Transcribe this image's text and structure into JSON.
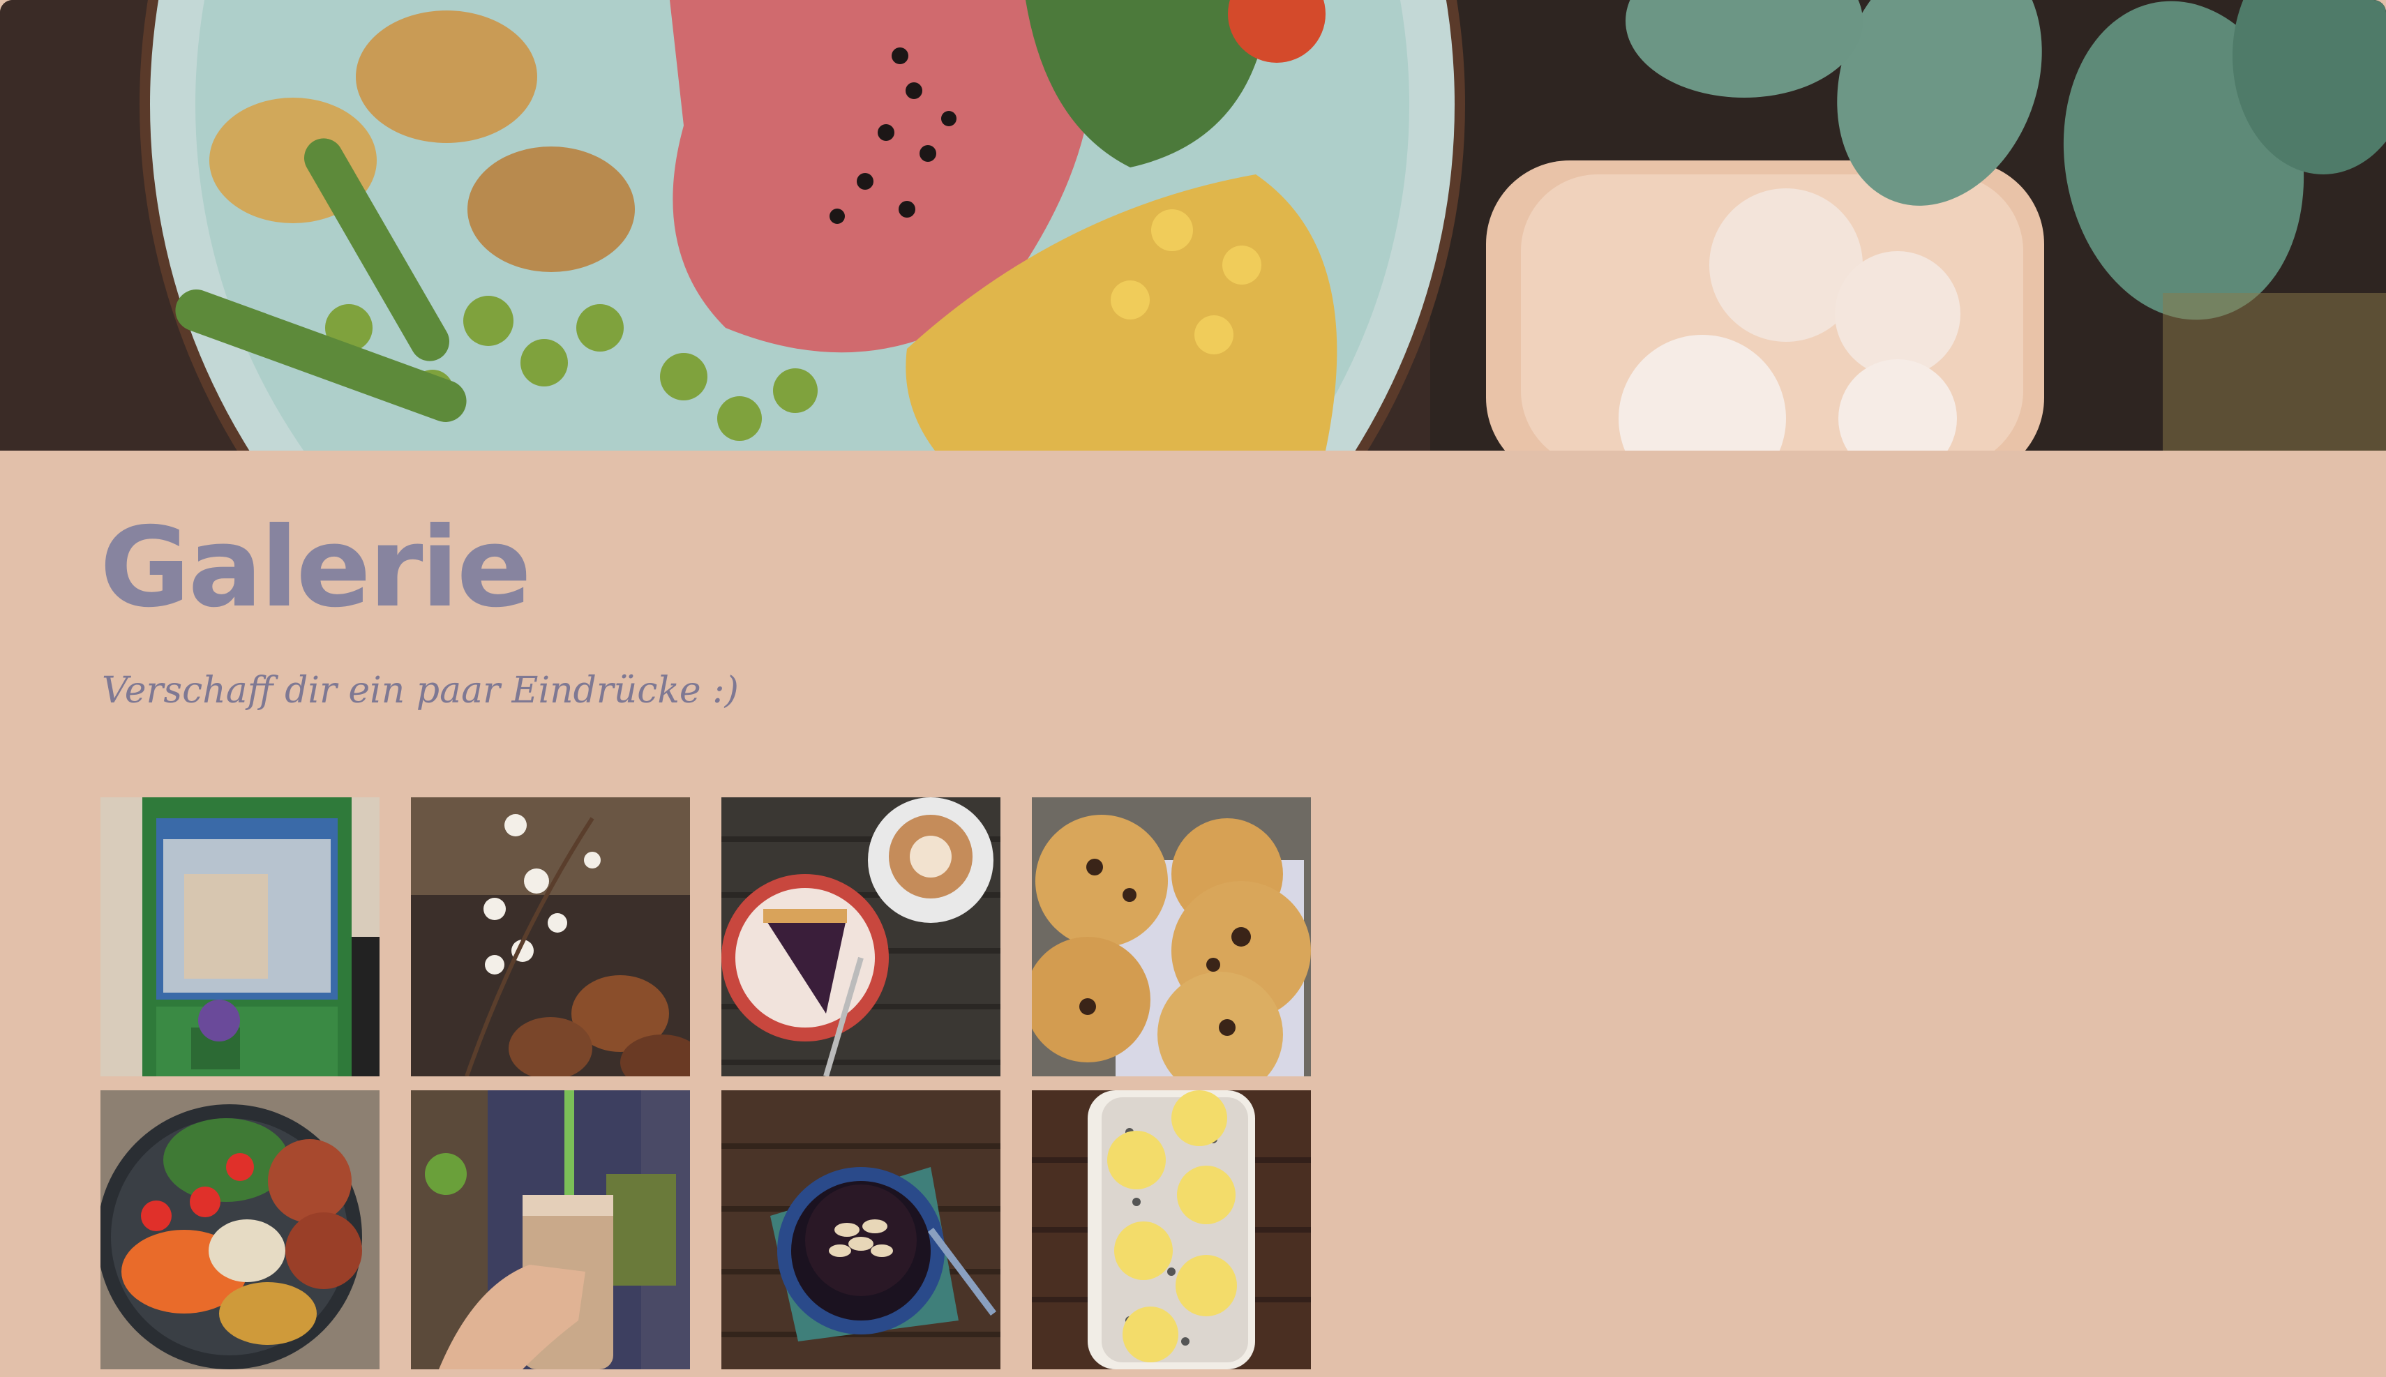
{
  "page": {
    "title": "Galerie",
    "subtitle": "Verschaff dir ein paar Eindrücke :)"
  },
  "hero": {
    "image": "food-bowl-and-iced-drink-photo"
  },
  "gallery": {
    "items": [
      {
        "image": "cafe-storefront-photo"
      },
      {
        "image": "cherry-blossom-cafe-photo"
      },
      {
        "image": "berry-tart-and-latte-photo"
      },
      {
        "image": "chocolate-chip-scones-photo"
      },
      {
        "image": "salad-bowl-photo"
      },
      {
        "image": "iced-coffee-in-hand-photo"
      },
      {
        "image": "chocolate-dessert-bowl-photo"
      },
      {
        "image": "pineapple-poppyseed-cake-photo"
      }
    ]
  },
  "colors": {
    "background": "#e2c0aa",
    "title": "#87849f",
    "subtitle": "#7e7893"
  }
}
